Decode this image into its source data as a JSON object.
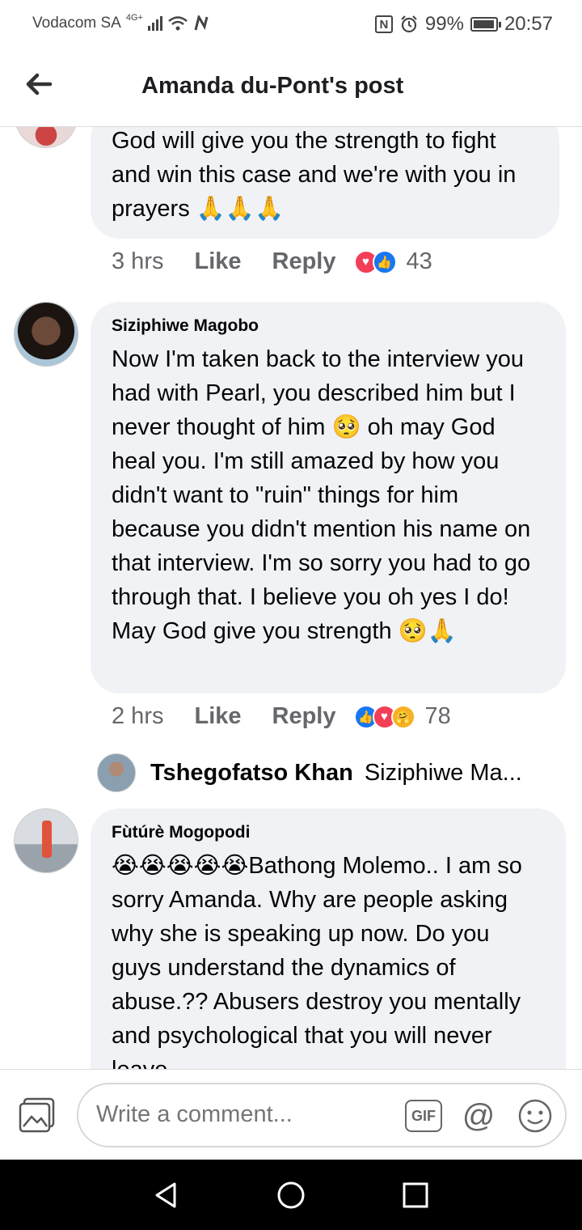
{
  "status_bar": {
    "carrier": "Vodacom SA",
    "network": "4G+",
    "battery": "99%",
    "time": "20:57"
  },
  "header": {
    "title": "Amanda du-Pont's post"
  },
  "comments": [
    {
      "author": "",
      "text": "God will give you the strength to fight and win this case and we're with you in prayers 🙏🙏🙏",
      "time": "3 hrs",
      "like_label": "Like",
      "reply_label": "Reply",
      "reactions": [
        "love-icon",
        "like-icon"
      ],
      "count": "43"
    },
    {
      "author": "Siziphiwe Magobo",
      "text": "Now I'm taken back to the interview you had with Pearl, you described him but I never thought of him 🥺 oh may God heal you. I'm still amazed by how you didn't want to \"ruin\" things for him because you didn't mention his name on that interview.  I'm so sorry you had to go through that. I believe you oh yes I do! May God give you strength 🥺🙏",
      "time": "2 hrs",
      "like_label": "Like",
      "reply_label": "Reply",
      "reactions": [
        "like-icon",
        "love-icon",
        "care-icon"
      ],
      "count": "78"
    },
    {
      "author": "Fùtúrè Mogopodi",
      "text": "😭😭😭😭😭Bathong Molemo.. I am so sorry Amanda. Why are people asking why she is speaking up now. Do you guys understand the dynamics of abuse.?? Abusers destroy you mentally and psychological that you will never leave"
    }
  ],
  "reply_preview": {
    "name": "Tshegofatso Khan",
    "snippet": "Siziphiwe Ma..."
  },
  "composer": {
    "placeholder": "Write a comment...",
    "gif_label": "GIF",
    "at_label": "@"
  },
  "colors": {
    "bubble": "#f0f2f5",
    "like_blue": "#1877f2",
    "love_red": "#f33e58",
    "muted": "#65676b"
  }
}
